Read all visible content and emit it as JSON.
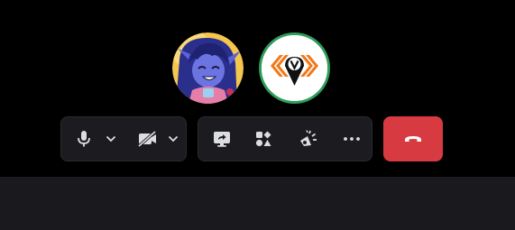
{
  "call": {
    "participants": [
      {
        "name": "participant-avatar-1",
        "kind": "anime-character-avatar"
      },
      {
        "name": "participant-avatar-2",
        "kind": "logo-avatar",
        "logo_letter": "v",
        "speaking_ring": "#2f9e5b"
      }
    ],
    "controls": {
      "media_group": [
        {
          "id": "microphone",
          "icon": "microphone-icon"
        },
        {
          "id": "microphone-options",
          "icon": "chevron-down-icon"
        },
        {
          "id": "camera",
          "icon": "camera-off-icon",
          "state": "off"
        },
        {
          "id": "camera-options",
          "icon": "chevron-down-icon"
        }
      ],
      "actions_group": [
        {
          "id": "share-screen",
          "icon": "screen-share-icon"
        },
        {
          "id": "activities",
          "icon": "activities-icon"
        },
        {
          "id": "soundboard",
          "icon": "soundboard-icon"
        },
        {
          "id": "more",
          "icon": "more-icon"
        }
      ],
      "end_call": {
        "id": "end-call",
        "icon": "hang-up-icon"
      }
    }
  },
  "colors": {
    "stage_background": "#000000",
    "bottom_bar": "#1a1a1e",
    "control_group_background": "#1c1c20",
    "icon": "#dcdde1",
    "end_call": "#d83a42",
    "speaking_ring": "#2f9e5b",
    "logo_orange": "#f07a1a"
  }
}
